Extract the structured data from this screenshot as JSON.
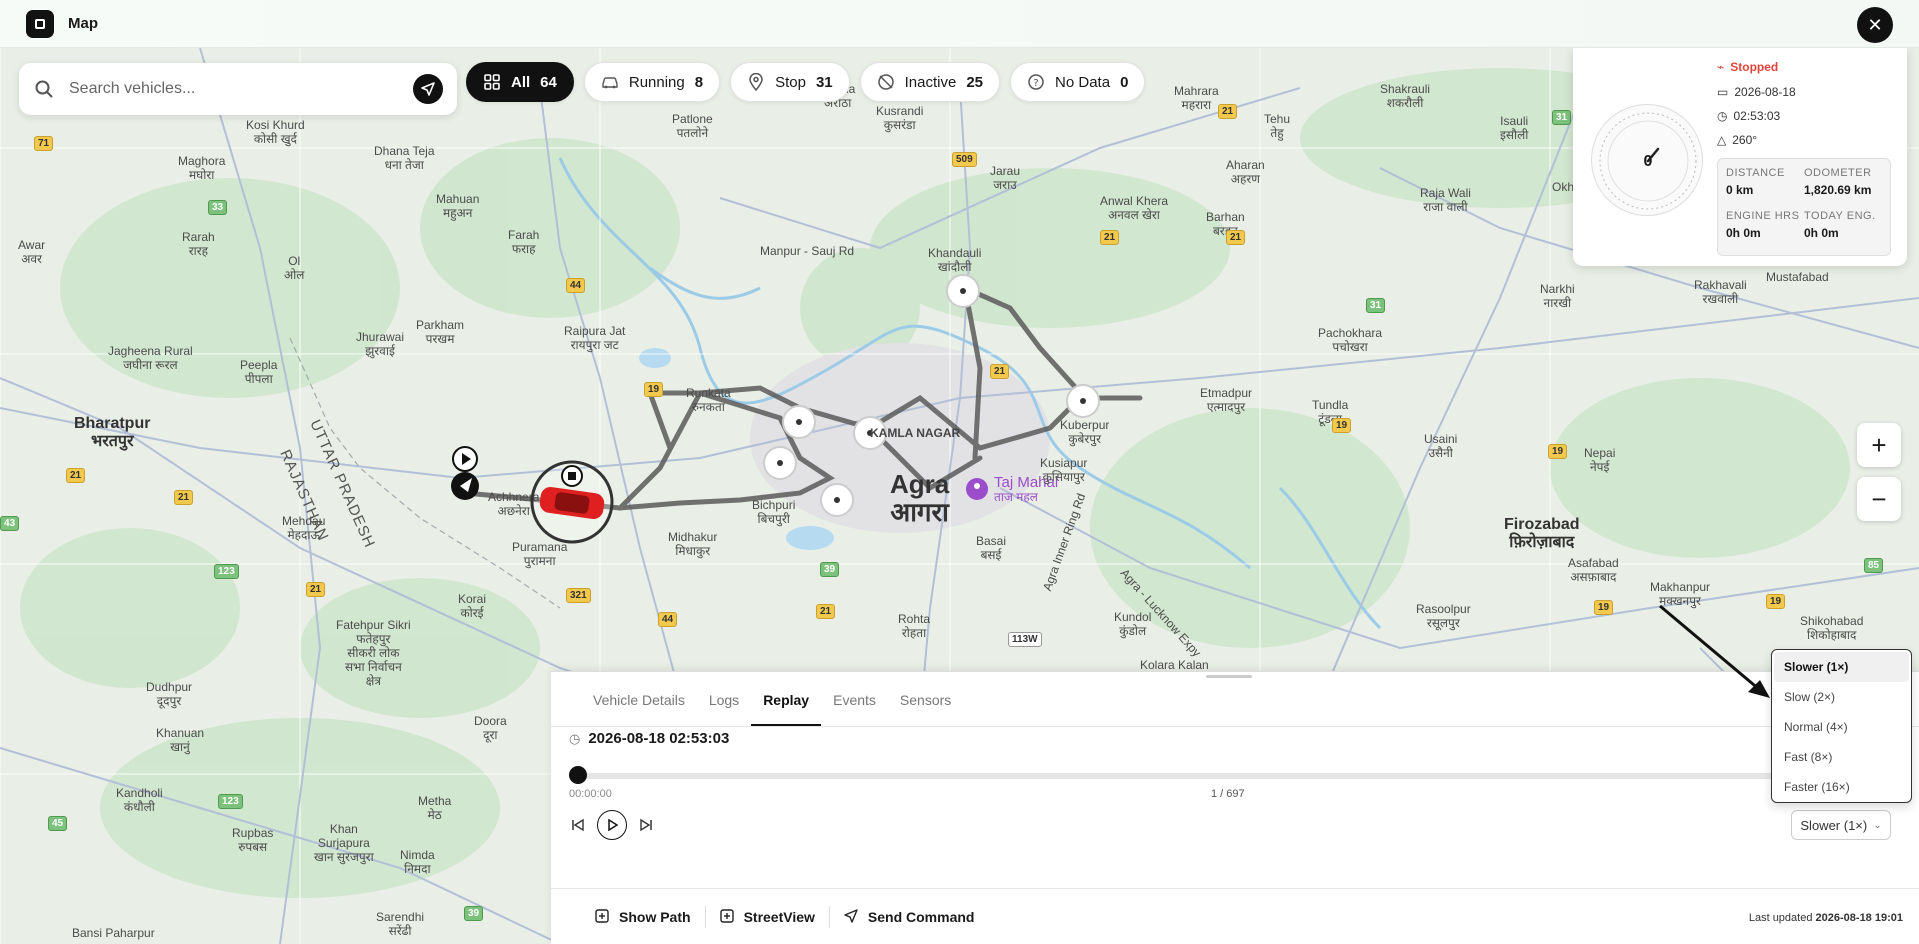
{
  "header": {
    "title": "Map",
    "close_label": "✕"
  },
  "search": {
    "placeholder": "Search vehicles..."
  },
  "filters": [
    {
      "label": "All",
      "count": "64"
    },
    {
      "label": "Running",
      "count": "8"
    },
    {
      "label": "Stop",
      "count": "31"
    },
    {
      "label": "Inactive",
      "count": "25"
    },
    {
      "label": "No Data",
      "count": "0"
    }
  ],
  "status": {
    "state": "Stopped",
    "date": "2026-08-18",
    "time": "02:53:03",
    "heading": "260°",
    "speed": "0",
    "distance_label": "DISTANCE",
    "distance": "0 km",
    "odometer_label": "ODOMETER",
    "odometer": "1,820.69 km",
    "engine_label": "ENGINE HRS",
    "engine": "0h 0m",
    "today_label": "TODAY ENG.",
    "today": "0h 0m"
  },
  "zoom": {
    "in": "+",
    "out": "−"
  },
  "tabs": [
    "Vehicle Details",
    "Logs",
    "Replay",
    "Events",
    "Sensors"
  ],
  "replay": {
    "datetime": "2026-08-18 02:53:03",
    "start_time": "00:00:00",
    "counter": "1 / 697",
    "progress": 0.0,
    "speed_value": "Slower (1×)"
  },
  "speed_options": [
    "Slower (1×)",
    "Slow (2×)",
    "Normal (4×)",
    "Fast (8×)",
    "Faster (16×)"
  ],
  "footer": {
    "show_path": "Show Path",
    "streetview": "StreetView",
    "send_command": "Send Command",
    "last_updated_label": "Last updated",
    "last_updated": "2026-08-18 19:01"
  },
  "map": {
    "city": "Agra",
    "city_hi": "आगरा",
    "poi": "Taj Mahal",
    "poi_hi": "ताज महल",
    "places": [
      {
        "t": "Bharatpur\nभरतपुर",
        "k": "mid"
      },
      {
        "t": "Firozabad\nफ़िरोज़ाबाद",
        "k": "mid"
      },
      {
        "t": "UTTAR PRADESH",
        "k": "state"
      },
      {
        "t": "RAJASTHAN",
        "k": "state"
      },
      {
        "t": "KAMLA NAGAR",
        "k": ""
      },
      {
        "t": "Maghora\nमघोरा",
        "k": ""
      },
      {
        "t": "Rarah\nरारह",
        "k": ""
      },
      {
        "t": "Awar\nअवर",
        "k": ""
      },
      {
        "t": "Ol\nओल",
        "k": ""
      },
      {
        "t": "Dhana Teja\nधना तेजा",
        "k": ""
      },
      {
        "t": "Mahuan\nमहुअन",
        "k": ""
      },
      {
        "t": "Farah\nफराह",
        "k": ""
      },
      {
        "t": "Parkham\nपरखम",
        "k": ""
      },
      {
        "t": "Jhurawai\nझुरवाई",
        "k": ""
      },
      {
        "t": "Jagheena Rural\nजघीना रूरल",
        "k": ""
      },
      {
        "t": "Peepla\nपीपला",
        "k": ""
      },
      {
        "t": "Raipura Jat\nरायपुरा जट",
        "k": ""
      },
      {
        "t": "Patlone\nपतलोने",
        "k": ""
      },
      {
        "t": "Arotha\nअरोठा",
        "k": ""
      },
      {
        "t": "Jarau\nजराउ",
        "k": ""
      },
      {
        "t": "Khandauli\nखांदौली",
        "k": ""
      },
      {
        "t": "Anwal Khera\nअनवल खेरा",
        "k": ""
      },
      {
        "t": "Mahrara\nमहरारा",
        "k": ""
      },
      {
        "t": "Tehu\nतेहु",
        "k": ""
      },
      {
        "t": "Aharan\nअहरण",
        "k": ""
      },
      {
        "t": "Barhan\nबरहन",
        "k": ""
      },
      {
        "t": "Shakrauli\nशकरौली",
        "k": ""
      },
      {
        "t": "Isauli\nइसौली",
        "k": ""
      },
      {
        "t": "Raja Wali\nराजा वाली",
        "k": ""
      },
      {
        "t": "Pachokhara\nपचोखरा",
        "k": ""
      },
      {
        "t": "Etmadpur\nएत्मादपुर",
        "k": ""
      },
      {
        "t": "Tundla\nटूंडला",
        "k": ""
      },
      {
        "t": "Usaini\nउसैनी",
        "k": ""
      },
      {
        "t": "Nepai\nनेपई",
        "k": ""
      },
      {
        "t": "Runkata\nरुनकता",
        "k": ""
      },
      {
        "t": "Achhnera\nअछनेरा",
        "k": ""
      },
      {
        "t": "Puramana\nपुरामना",
        "k": ""
      },
      {
        "t": "Midhakur\nमिधाकुर",
        "k": ""
      },
      {
        "t": "Bichpuri\nबिचपुरी",
        "k": ""
      },
      {
        "t": "Basai\nबसई",
        "k": ""
      },
      {
        "t": "Rohta\nरोहता",
        "k": ""
      },
      {
        "t": "Kundol\nकुंडोल",
        "k": ""
      },
      {
        "t": "Kolara Kalan",
        "k": ""
      },
      {
        "t": "Kusiapur\nकुसियापुर",
        "k": ""
      },
      {
        "t": "Mehdau\nमेहदाऊ",
        "k": ""
      },
      {
        "t": "Korai\nकोरई",
        "k": ""
      },
      {
        "t": "Fatehpur Sikri\nफतेहपुर\nसीकरी लोक\nसभा निर्वाचन\nक्षेत्र",
        "k": ""
      },
      {
        "t": "Dudhpur\nदूदपुर",
        "k": ""
      },
      {
        "t": "Khanuan\nखानुं",
        "k": ""
      },
      {
        "t": "Kandholi\nकंधौली",
        "k": ""
      },
      {
        "t": "Rupbas\nरुपबस",
        "k": ""
      },
      {
        "t": "Khan\nSurjapura\nखान सुरजपुरा",
        "k": ""
      },
      {
        "t": "Doora\nदूरा",
        "k": ""
      },
      {
        "t": "Metha\nमेठ",
        "k": ""
      },
      {
        "t": "Nimda\nनिमदा",
        "k": ""
      },
      {
        "t": "Sarendhi\nसरेंढी",
        "k": ""
      },
      {
        "t": "Bansi Paharpur",
        "k": ""
      },
      {
        "t": "Makhanpur\nमक्खनपुर",
        "k": ""
      },
      {
        "t": "Asafabad\nअसफ़ाबाद",
        "k": ""
      },
      {
        "t": "Shikohabad\nशिकोहाबाद",
        "k": ""
      },
      {
        "t": "Rakhavali\nरखवाली",
        "k": ""
      },
      {
        "t": "Narkhi\nनारखी",
        "k": ""
      },
      {
        "t": "Kusrandi\nकुसरंडा",
        "k": ""
      },
      {
        "t": "Kosi Khurd\nकोसी खुर्द",
        "k": ""
      },
      {
        "t": "Okh",
        "k": ""
      },
      {
        "t": "Mustafabad",
        "k": ""
      },
      {
        "t": "Kuberpur\nकुबेरपुर",
        "k": ""
      },
      {
        "t": "Rasoolpur\nरसूलपुर",
        "k": ""
      },
      {
        "t": "Manpur - Sauj Rd",
        "k": ""
      },
      {
        "t": "Agra Inner Ring Rd",
        "k": ""
      },
      {
        "t": "Agra - Lucknow Expy",
        "k": ""
      }
    ],
    "shields": [
      "71",
      "33",
      "44",
      "509",
      "19",
      "21",
      "21",
      "21",
      "19",
      "19",
      "21",
      "21",
      "123",
      "21",
      "321",
      "39",
      "21",
      "44",
      "113W",
      "19",
      "31",
      "21",
      "31",
      "85",
      "19",
      "45",
      "123",
      "39",
      "43"
    ]
  }
}
